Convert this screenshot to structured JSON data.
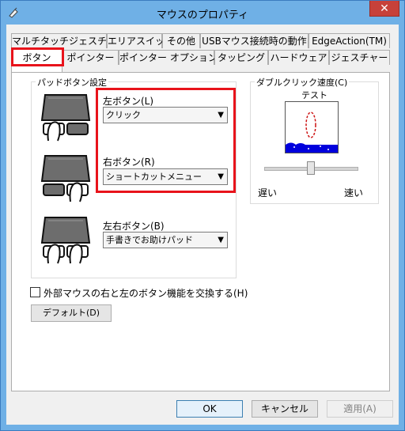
{
  "window": {
    "title": "マウスのプロパティ",
    "close_glyph": "✕"
  },
  "tabs_row1": [
    {
      "label": "マルチタッチジェスチャー"
    },
    {
      "label": "エリアスイッチ"
    },
    {
      "label": "その他"
    },
    {
      "label": "USBマウス接続時の動作"
    },
    {
      "label": "EdgeAction(TM)"
    }
  ],
  "tabs_row2": [
    {
      "label": "ボタン"
    },
    {
      "label": "ポインター"
    },
    {
      "label": "ポインター オプション"
    },
    {
      "label": "タッピング"
    },
    {
      "label": "ハードウェア"
    },
    {
      "label": "ジェスチャー"
    }
  ],
  "pad_buttons": {
    "group_label": "パッドボタン設定",
    "left": {
      "label": "左ボタン(L)",
      "value": "クリック"
    },
    "right": {
      "label": "右ボタン(R)",
      "value": "ショートカットメニュー"
    },
    "both": {
      "label": "左右ボタン(B)",
      "value": "手書きでお助けパッド"
    }
  },
  "double_click": {
    "group_label": "ダブルクリック速度(C)",
    "test_label": "テスト",
    "slow_label": "遅い",
    "fast_label": "速い",
    "speed_fraction": 0.5
  },
  "swap_checkbox": {
    "label": "外部マウスの右と左のボタン機能を交換する(H)",
    "checked": false
  },
  "default_button": "デフォルト(D)",
  "footer": {
    "ok": "OK",
    "cancel": "キャンセル",
    "apply": "適用(A)"
  },
  "colors": {
    "highlight": "#e8131b",
    "titlebar": "#6fb0e6"
  }
}
